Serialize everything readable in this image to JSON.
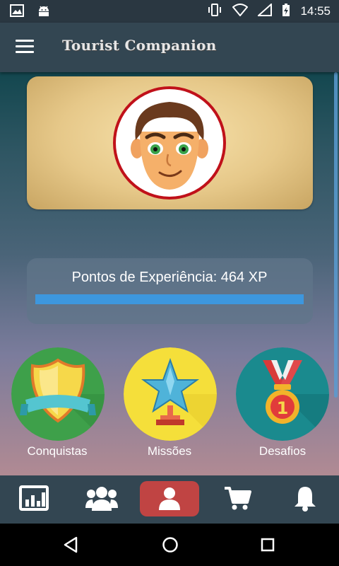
{
  "status_bar": {
    "time": "14:55",
    "icons_left": [
      "image-icon",
      "android-icon"
    ],
    "icons_right": [
      "vibrate-icon",
      "wifi-icon",
      "no-signal-icon",
      "battery-charging-icon"
    ]
  },
  "app_bar": {
    "title": "Tourist Companion",
    "menu_icon": "hamburger-menu-icon"
  },
  "profile": {
    "avatar_icon": "user-avatar-face-icon"
  },
  "experience": {
    "label": "Pontos de Experiência: 464 XP",
    "progress": 1.0
  },
  "badges": [
    {
      "label": "Conquistas",
      "icon": "shield-ribbon-icon",
      "color": "#3ea04a"
    },
    {
      "label": "Missões",
      "icon": "star-trophy-icon",
      "color": "#f5df3a"
    },
    {
      "label": "Desafios",
      "icon": "medal-icon",
      "color": "#1a8a8e"
    }
  ],
  "bottom_nav": {
    "items": [
      {
        "name": "stats",
        "icon": "bar-chart-icon"
      },
      {
        "name": "friends",
        "icon": "group-icon"
      },
      {
        "name": "profile",
        "icon": "person-icon",
        "active": true
      },
      {
        "name": "shop",
        "icon": "cart-icon"
      },
      {
        "name": "notifications",
        "icon": "bell-icon"
      }
    ],
    "active_color": "#c04443"
  },
  "system_nav": [
    "back-icon",
    "home-icon",
    "recents-icon"
  ]
}
